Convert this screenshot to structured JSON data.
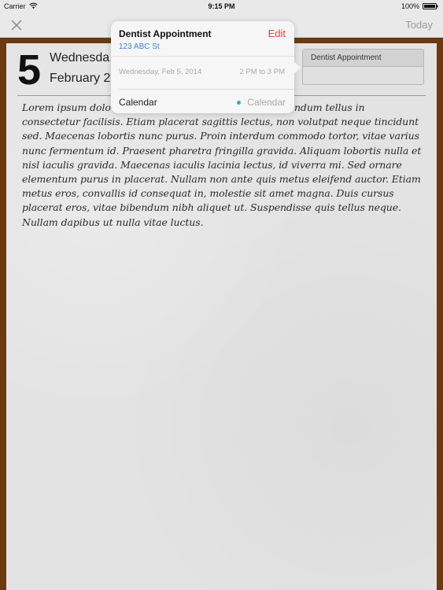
{
  "status_bar": {
    "carrier": "Carrier",
    "time": "9:15 PM",
    "battery": "100%",
    "icons": [
      "wifi-icon",
      "battery-icon"
    ]
  },
  "nav": {
    "close_icon": "close-icon",
    "today_label": "Today"
  },
  "day": {
    "number": "5",
    "weekday": "Wednesda",
    "month_date": "February 2"
  },
  "note": {
    "text": "Lorem ipsum dolo                                                    t. Donec eget auctor erat. Nunc bibendum tellus in consectetur facilisis. Etiam placerat sagittis lectus, non volutpat neque tincidunt sed. Maecenas lobortis nunc purus. Proin interdum commodo tortor, vitae varius nunc fermentum id. Praesent pharetra fringilla gravida. Aliquam lobortis nulla et nisl iaculis gravida. Maecenas iaculis lacinia lectus, id viverra mi. Sed ornare elementum purus in placerat. Nullam non ante quis metus eleifend auctor. Etiam metus eros, convallis id consequat in, molestie sit amet magna. Duis cursus placerat eros, vitae bibendum nibh aliquet ut. Suspendisse quis tellus neque. Nullam dapibus ut nulla vitae luctus."
  },
  "event_chip": {
    "title": "Dentist Appointment"
  },
  "popover": {
    "title": "Dentist Appointment",
    "edit_label": "Edit",
    "location": "123 ABC St",
    "date": "Wednesday, Feb 5, 2014",
    "time": "2 PM to 3 PM",
    "calendar_label": "Calendar",
    "calendar_value": "Calendar"
  },
  "colors": {
    "frame": "#6b3a10",
    "paper": "#e3e3e3",
    "edit": "#e5403b",
    "link": "#3c84d2",
    "calendar_dot": "#3aa2e0"
  }
}
